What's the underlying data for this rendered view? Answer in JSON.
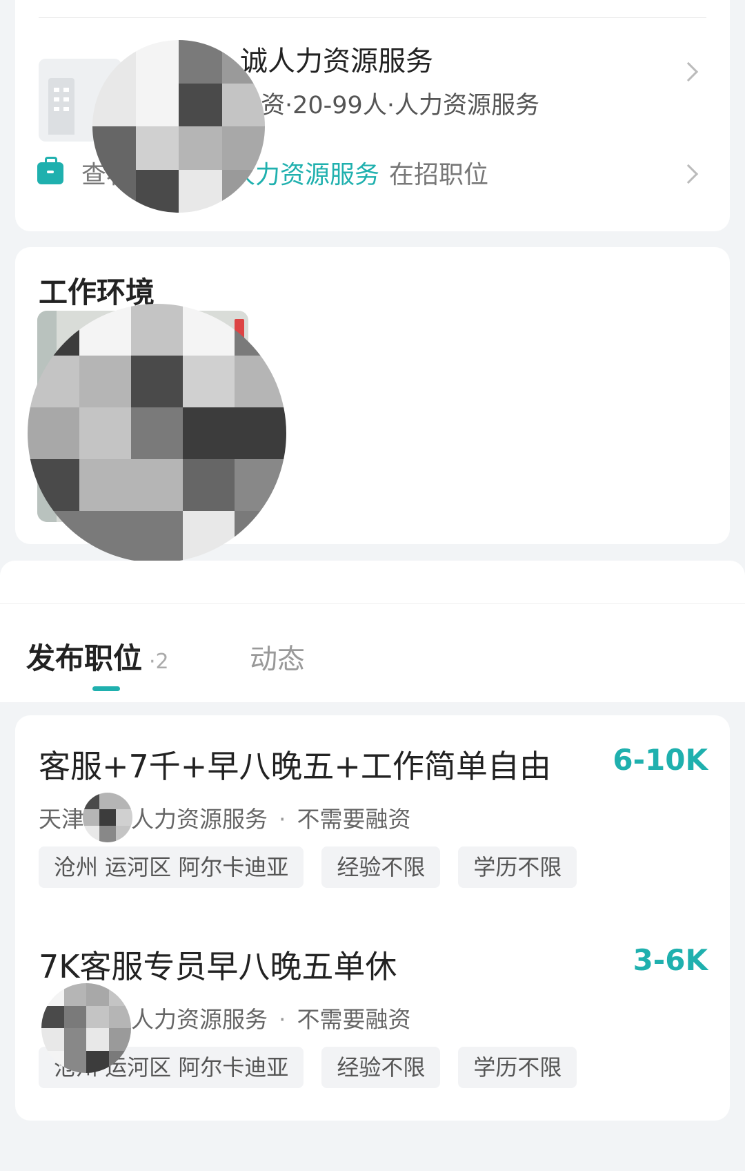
{
  "company": {
    "name": "诚人力资源服务",
    "meta": "资·20-99人·人力资源服务",
    "jobs_link": {
      "prefix": "查看",
      "company": "诚人力资源服务",
      "suffix": "在招职位"
    }
  },
  "environment": {
    "title": "工作环境"
  },
  "tabs": {
    "jobs_label": "发布职位",
    "jobs_count": "·2",
    "moments_label": "动态"
  },
  "jobs": [
    {
      "title": "客服+7千+早八晚五+工作简单自由",
      "salary": "6-10K",
      "company_prefix": "天津",
      "company_rest": "人力资源服务",
      "funding": "不需要融资",
      "location": "沧州 运河区 阿尔卡迪亚",
      "experience": "经验不限",
      "education": "学历不限"
    },
    {
      "title": "7K客服专员早八晚五单休",
      "salary": "3-6K",
      "company_prefix": "",
      "company_rest": "人力资源服务",
      "funding": "不需要融资",
      "location": "沧州 运河区 阿尔卡迪亚",
      "experience": "经验不限",
      "education": "学历不限"
    }
  ],
  "colors": {
    "accent": "#1fb0ae",
    "page_bg": "#f2f4f6",
    "card_bg": "#ffffff"
  }
}
